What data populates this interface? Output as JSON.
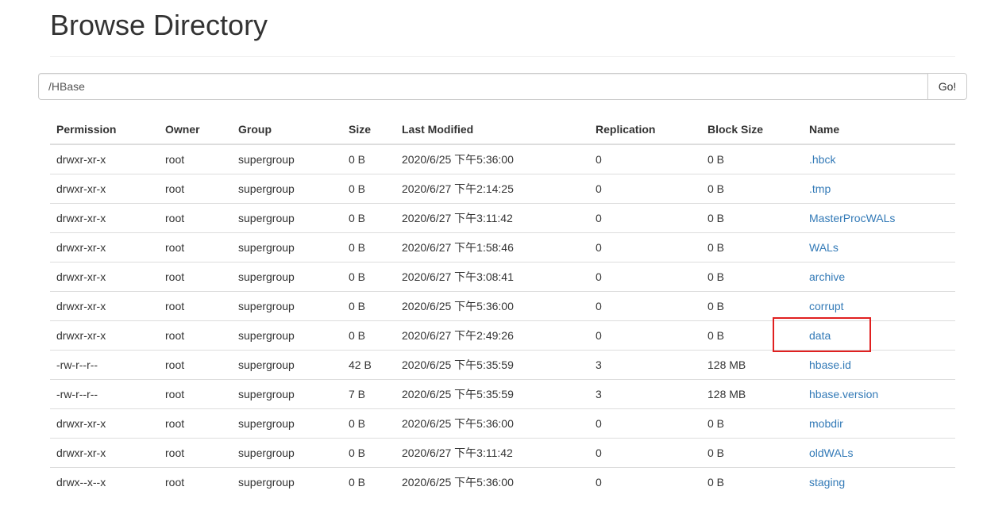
{
  "page": {
    "title": "Browse Directory"
  },
  "path_form": {
    "value": "/HBase",
    "go_label": "Go!"
  },
  "table": {
    "headers": [
      "Permission",
      "Owner",
      "Group",
      "Size",
      "Last Modified",
      "Replication",
      "Block Size",
      "Name"
    ],
    "rows": [
      {
        "permission": "drwxr-xr-x",
        "owner": "root",
        "group": "supergroup",
        "size": "0 B",
        "modified": "2020/6/25 下午5:36:00",
        "replication": "0",
        "block_size": "0 B",
        "name": ".hbck"
      },
      {
        "permission": "drwxr-xr-x",
        "owner": "root",
        "group": "supergroup",
        "size": "0 B",
        "modified": "2020/6/27 下午2:14:25",
        "replication": "0",
        "block_size": "0 B",
        "name": ".tmp"
      },
      {
        "permission": "drwxr-xr-x",
        "owner": "root",
        "group": "supergroup",
        "size": "0 B",
        "modified": "2020/6/27 下午3:11:42",
        "replication": "0",
        "block_size": "0 B",
        "name": "MasterProcWALs"
      },
      {
        "permission": "drwxr-xr-x",
        "owner": "root",
        "group": "supergroup",
        "size": "0 B",
        "modified": "2020/6/27 下午1:58:46",
        "replication": "0",
        "block_size": "0 B",
        "name": "WALs"
      },
      {
        "permission": "drwxr-xr-x",
        "owner": "root",
        "group": "supergroup",
        "size": "0 B",
        "modified": "2020/6/27 下午3:08:41",
        "replication": "0",
        "block_size": "0 B",
        "name": "archive"
      },
      {
        "permission": "drwxr-xr-x",
        "owner": "root",
        "group": "supergroup",
        "size": "0 B",
        "modified": "2020/6/25 下午5:36:00",
        "replication": "0",
        "block_size": "0 B",
        "name": "corrupt"
      },
      {
        "permission": "drwxr-xr-x",
        "owner": "root",
        "group": "supergroup",
        "size": "0 B",
        "modified": "2020/6/27 下午2:49:26",
        "replication": "0",
        "block_size": "0 B",
        "name": "data"
      },
      {
        "permission": "-rw-r--r--",
        "owner": "root",
        "group": "supergroup",
        "size": "42 B",
        "modified": "2020/6/25 下午5:35:59",
        "replication": "3",
        "block_size": "128 MB",
        "name": "hbase.id"
      },
      {
        "permission": "-rw-r--r--",
        "owner": "root",
        "group": "supergroup",
        "size": "7 B",
        "modified": "2020/6/25 下午5:35:59",
        "replication": "3",
        "block_size": "128 MB",
        "name": "hbase.version"
      },
      {
        "permission": "drwxr-xr-x",
        "owner": "root",
        "group": "supergroup",
        "size": "0 B",
        "modified": "2020/6/25 下午5:36:00",
        "replication": "0",
        "block_size": "0 B",
        "name": "mobdir"
      },
      {
        "permission": "drwxr-xr-x",
        "owner": "root",
        "group": "supergroup",
        "size": "0 B",
        "modified": "2020/6/27 下午3:11:42",
        "replication": "0",
        "block_size": "0 B",
        "name": "oldWALs"
      },
      {
        "permission": "drwx--x--x",
        "owner": "root",
        "group": "supergroup",
        "size": "0 B",
        "modified": "2020/6/25 下午5:36:00",
        "replication": "0",
        "block_size": "0 B",
        "name": "staging"
      }
    ]
  },
  "colors": {
    "link": "#337ab7",
    "highlight": "#e02020",
    "text": "#333333",
    "border": "#dddddd"
  }
}
